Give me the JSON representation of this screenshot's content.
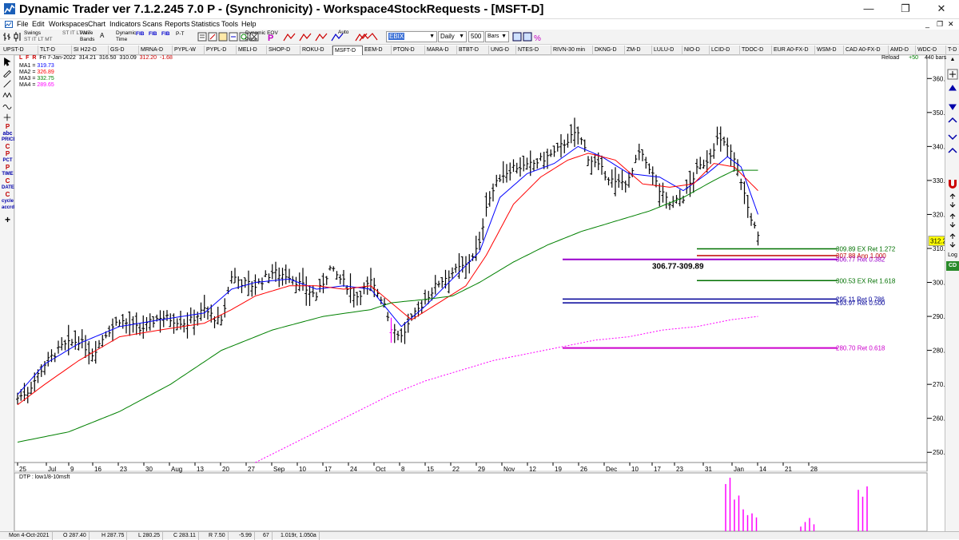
{
  "window": {
    "title": "Dynamic Trader ver 7.1.2.245 7.0 P - (Synchronicity) - Workspace4StockRequests - [MSFT-D]",
    "minimize": "—",
    "restore": "❐",
    "close": "✕"
  },
  "menu": [
    "File",
    "Edit",
    "Workspaces",
    "Chart",
    "Indicators",
    "Scans",
    "Reports",
    "Statistics",
    "Tools",
    "Help"
  ],
  "toolbar": {
    "swings": "Swings",
    "swing_sub": "ST IT LT MT",
    "wave_bands": "Wave\nBands",
    "wave_a": "A",
    "dynamic_time": "Dynamic\nTime",
    "fib": "FIB",
    "pt": "P-T",
    "dynamic_eov_price": "Dynamic EOV\nPrice",
    "auto": "Auto",
    "symbol_value": "EBIX",
    "period_value": "Daily",
    "bars_count": "500",
    "bars_unit": "Bars"
  },
  "tabs": [
    "UPST-D",
    "TLT-D",
    "SI H22-D",
    "GS-D",
    "MRNA-D",
    "PYPL-W",
    "PYPL-D",
    "MELI-D",
    "SHOP-D",
    "ROKU-D",
    "MSFT-D",
    "EEM-D",
    "PTON-D",
    "MARA-D",
    "BTBT-D",
    "UNG-D",
    "NTES-D",
    "RIVN-30 min",
    "DKNG-D",
    "ZM-D",
    "LULU-D",
    "NIO-D",
    "LCID-D",
    "TDOC-D",
    "EUR A0-FX-D",
    "WSM-D",
    "CAD A0-FX-D",
    "AMD-D",
    "WDC-D",
    "T-D"
  ],
  "active_tab": "MSFT-D",
  "reload": {
    "label": "Reload",
    "delta": "+50",
    "bars": "440 bars"
  },
  "header_info": {
    "flags": [
      "L",
      "F",
      "R"
    ],
    "date": "Fri 7-Jan-2022",
    "open": "314.21",
    "high": "316.50",
    "low": "310.09",
    "close": "312.20",
    "change": "-1.68"
  },
  "moving_averages": [
    {
      "label": "MA1 = ",
      "value": "319.73",
      "color": "#0000ff"
    },
    {
      "label": "MA2 = ",
      "value": "326.89",
      "color": "#ff0000"
    },
    {
      "label": "MA3 = ",
      "value": "332.75",
      "color": "#008000"
    },
    {
      "label": "MA4 = ",
      "value": "289.65",
      "color": "#ff00ff"
    }
  ],
  "left_tools": [
    "P",
    "abc",
    "PRICE",
    "C",
    "P",
    "PCT",
    "P",
    "TIME",
    "C",
    "DATE",
    "C",
    "cycle",
    "accrd",
    "+"
  ],
  "right_tools": [
    "Log",
    "CD"
  ],
  "chart_data": {
    "type": "ohlc",
    "y_axis": {
      "ticks": [
        "360.00",
        "350.00",
        "340.00",
        "330.00",
        "320.00",
        "310.00",
        "300.00",
        "290.00",
        "280.00",
        "270.00",
        "260.00",
        "250.00"
      ],
      "range": [
        247,
        365
      ]
    },
    "x_axis": {
      "labels": [
        "25",
        "Jul",
        "9",
        "16",
        "23",
        "30",
        "Aug",
        "13",
        "20",
        "27",
        "Sep",
        "10",
        "17",
        "24",
        "Oct",
        "8",
        "15",
        "22",
        "29",
        "Nov",
        "12",
        "19",
        "26",
        "Dec",
        "10",
        "17",
        "23",
        "31",
        "Jan",
        "14",
        "21",
        "28"
      ]
    },
    "last_price": "312.20",
    "last_price_color": "#ffff00",
    "anchors": [
      [
        0,
        266
      ],
      [
        3,
        268
      ],
      [
        8,
        276
      ],
      [
        13,
        281
      ],
      [
        18,
        283
      ],
      [
        22,
        279
      ],
      [
        26,
        285
      ],
      [
        30,
        289
      ],
      [
        36,
        286
      ],
      [
        42,
        290
      ],
      [
        50,
        288
      ],
      [
        55,
        292
      ],
      [
        60,
        288
      ],
      [
        63,
        302
      ],
      [
        66,
        300
      ],
      [
        70,
        299
      ],
      [
        75,
        303
      ],
      [
        80,
        302
      ],
      [
        85,
        298
      ],
      [
        88,
        296
      ],
      [
        92,
        304
      ],
      [
        96,
        300
      ],
      [
        100,
        296
      ],
      [
        104,
        300
      ],
      [
        108,
        294
      ],
      [
        110,
        287
      ],
      [
        113,
        284
      ],
      [
        116,
        289
      ],
      [
        120,
        295
      ],
      [
        124,
        300
      ],
      [
        128,
        303
      ],
      [
        132,
        305
      ],
      [
        136,
        311
      ],
      [
        138,
        323
      ],
      [
        142,
        331
      ],
      [
        146,
        334
      ],
      [
        150,
        334
      ],
      [
        154,
        336
      ],
      [
        158,
        338
      ],
      [
        162,
        342
      ],
      [
        165,
        344
      ],
      [
        168,
        337
      ],
      [
        172,
        333
      ],
      [
        176,
        329
      ],
      [
        180,
        330
      ],
      [
        183,
        338
      ],
      [
        186,
        334
      ],
      [
        189,
        327
      ],
      [
        192,
        323
      ],
      [
        196,
        325
      ],
      [
        200,
        333
      ],
      [
        203,
        336
      ],
      [
        206,
        342
      ],
      [
        209,
        340
      ],
      [
        212,
        334
      ],
      [
        215,
        322
      ],
      [
        217,
        316
      ],
      [
        218,
        313
      ]
    ],
    "series": [
      {
        "name": "MA1",
        "values": [
          [
            0,
            267
          ],
          [
            8,
            276
          ],
          [
            18,
            282
          ],
          [
            30,
            287
          ],
          [
            42,
            289
          ],
          [
            55,
            291
          ],
          [
            63,
            298
          ],
          [
            70,
            300
          ],
          [
            80,
            301
          ],
          [
            88,
            298
          ],
          [
            96,
            299
          ],
          [
            104,
            298
          ],
          [
            113,
            287
          ],
          [
            120,
            293
          ],
          [
            128,
            301
          ],
          [
            136,
            309
          ],
          [
            142,
            325
          ],
          [
            150,
            332
          ],
          [
            158,
            335
          ],
          [
            165,
            340
          ],
          [
            172,
            337
          ],
          [
            180,
            332
          ],
          [
            189,
            331
          ],
          [
            196,
            327
          ],
          [
            203,
            332
          ],
          [
            209,
            337
          ],
          [
            213,
            334
          ],
          [
            218,
            320
          ]
        ],
        "color": "#0000ff"
      },
      {
        "name": "MA2",
        "values": [
          [
            0,
            264
          ],
          [
            8,
            270
          ],
          [
            18,
            277
          ],
          [
            30,
            284
          ],
          [
            42,
            286
          ],
          [
            55,
            288
          ],
          [
            63,
            292
          ],
          [
            70,
            296
          ],
          [
            80,
            299
          ],
          [
            88,
            299
          ],
          [
            96,
            298
          ],
          [
            104,
            299
          ],
          [
            110,
            294
          ],
          [
            116,
            289
          ],
          [
            124,
            294
          ],
          [
            132,
            299
          ],
          [
            138,
            308
          ],
          [
            146,
            323
          ],
          [
            154,
            331
          ],
          [
            162,
            336
          ],
          [
            168,
            338
          ],
          [
            176,
            336
          ],
          [
            184,
            329
          ],
          [
            192,
            328
          ],
          [
            199,
            329
          ],
          [
            205,
            335
          ],
          [
            211,
            334
          ],
          [
            218,
            327
          ]
        ],
        "color": "#ff0000"
      },
      {
        "name": "MA3",
        "values": [
          [
            0,
            253
          ],
          [
            15,
            256
          ],
          [
            30,
            262
          ],
          [
            45,
            270
          ],
          [
            60,
            280
          ],
          [
            75,
            286
          ],
          [
            90,
            290
          ],
          [
            104,
            292
          ],
          [
            110,
            294
          ],
          [
            120,
            295
          ],
          [
            128,
            296
          ],
          [
            136,
            300
          ],
          [
            146,
            306
          ],
          [
            156,
            311
          ],
          [
            166,
            315
          ],
          [
            176,
            318
          ],
          [
            186,
            321
          ],
          [
            196,
            325
          ],
          [
            205,
            330
          ],
          [
            211,
            333
          ],
          [
            218,
            333
          ]
        ],
        "color": "#008000"
      },
      {
        "name": "MA4",
        "values": [
          [
            70,
            247
          ],
          [
            80,
            252
          ],
          [
            90,
            257
          ],
          [
            100,
            262
          ],
          [
            110,
            267
          ],
          [
            120,
            271
          ],
          [
            130,
            274
          ],
          [
            140,
            277
          ],
          [
            150,
            279
          ],
          [
            160,
            281
          ],
          [
            170,
            283
          ],
          [
            180,
            284
          ],
          [
            190,
            286
          ],
          [
            200,
            287
          ],
          [
            210,
            289
          ],
          [
            218,
            290
          ]
        ],
        "color": "#ff00ff",
        "style": "dotted"
      }
    ],
    "levels": [
      {
        "label": "309.89 EX Ret 1.272",
        "value": 309.89,
        "color": "#007000"
      },
      {
        "label": "307.88 Ann 1.000",
        "value": 307.88,
        "color": "#c00000"
      },
      {
        "label": "306.77 Ret 0.382",
        "value": 306.77,
        "color": "#9900cc"
      },
      {
        "label": "300.53 EX Ret 1.618",
        "value": 300.53,
        "color": "#007000"
      },
      {
        "label": "295.11 Ret 0.786",
        "value": 295.11,
        "color": "#000099"
      },
      {
        "label": "293.97 Ret 0.500",
        "value": 293.97,
        "color": "#000099"
      },
      {
        "label": "280.70 Ret 0.618",
        "value": 280.7,
        "color": "#cc00cc"
      }
    ],
    "zone_label": "306.77-309.89"
  },
  "indicator": {
    "label": "DTP : low1/8-10msft",
    "bars": [
      0.82,
      0.93,
      0.55,
      0.62,
      0.38,
      0.28,
      0.31,
      0.24,
      0.08,
      0.16,
      0.23,
      0.12,
      0.72,
      0.6,
      0.78
    ],
    "color": "#ff00ff"
  },
  "status": {
    "date": "Mon 4-Oct-2021",
    "open": "O 287.40",
    "high": "H 287.75",
    "low": "L 280.25",
    "close": "C 283.11",
    "range": "R 7.50",
    "change": "-5.99",
    "count": "67",
    "ratio": "1.019r, 1.050a"
  }
}
